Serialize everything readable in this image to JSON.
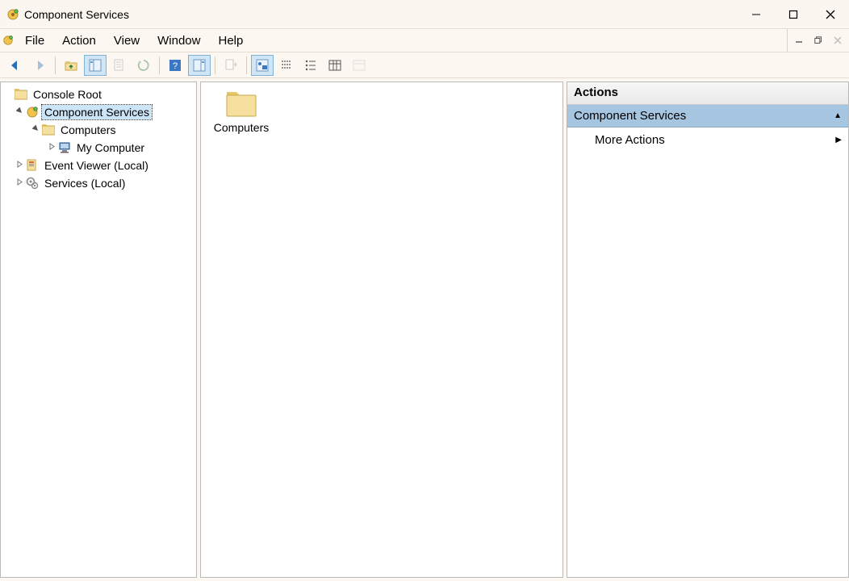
{
  "window": {
    "title": "Component Services"
  },
  "menu": {
    "file": "File",
    "action": "Action",
    "view": "View",
    "window": "Window",
    "help": "Help"
  },
  "toolbar_icons": {
    "back": "back-icon",
    "forward": "forward-icon",
    "up": "up-one-level-icon",
    "show_hide_tree": "show-hide-console-tree-icon",
    "properties": "properties-icon",
    "refresh": "refresh-icon",
    "help": "help-icon",
    "show_hide_actions": "show-hide-action-pane-icon",
    "export": "export-list-icon",
    "view_app": "view-application-icon",
    "view_detail1": "status-view-icon",
    "view_detail2": "list-view-icon",
    "view_detail3": "detail-view-icon",
    "view_detail4": "view-icon-disabled"
  },
  "tree": {
    "root": "Console Root",
    "component_services": "Component Services",
    "computers": "Computers",
    "my_computer": "My Computer",
    "event_viewer": "Event Viewer (Local)",
    "services": "Services (Local)"
  },
  "content": {
    "item0": "Computers"
  },
  "actions": {
    "header": "Actions",
    "section_title": "Component Services",
    "more_actions": "More Actions"
  }
}
